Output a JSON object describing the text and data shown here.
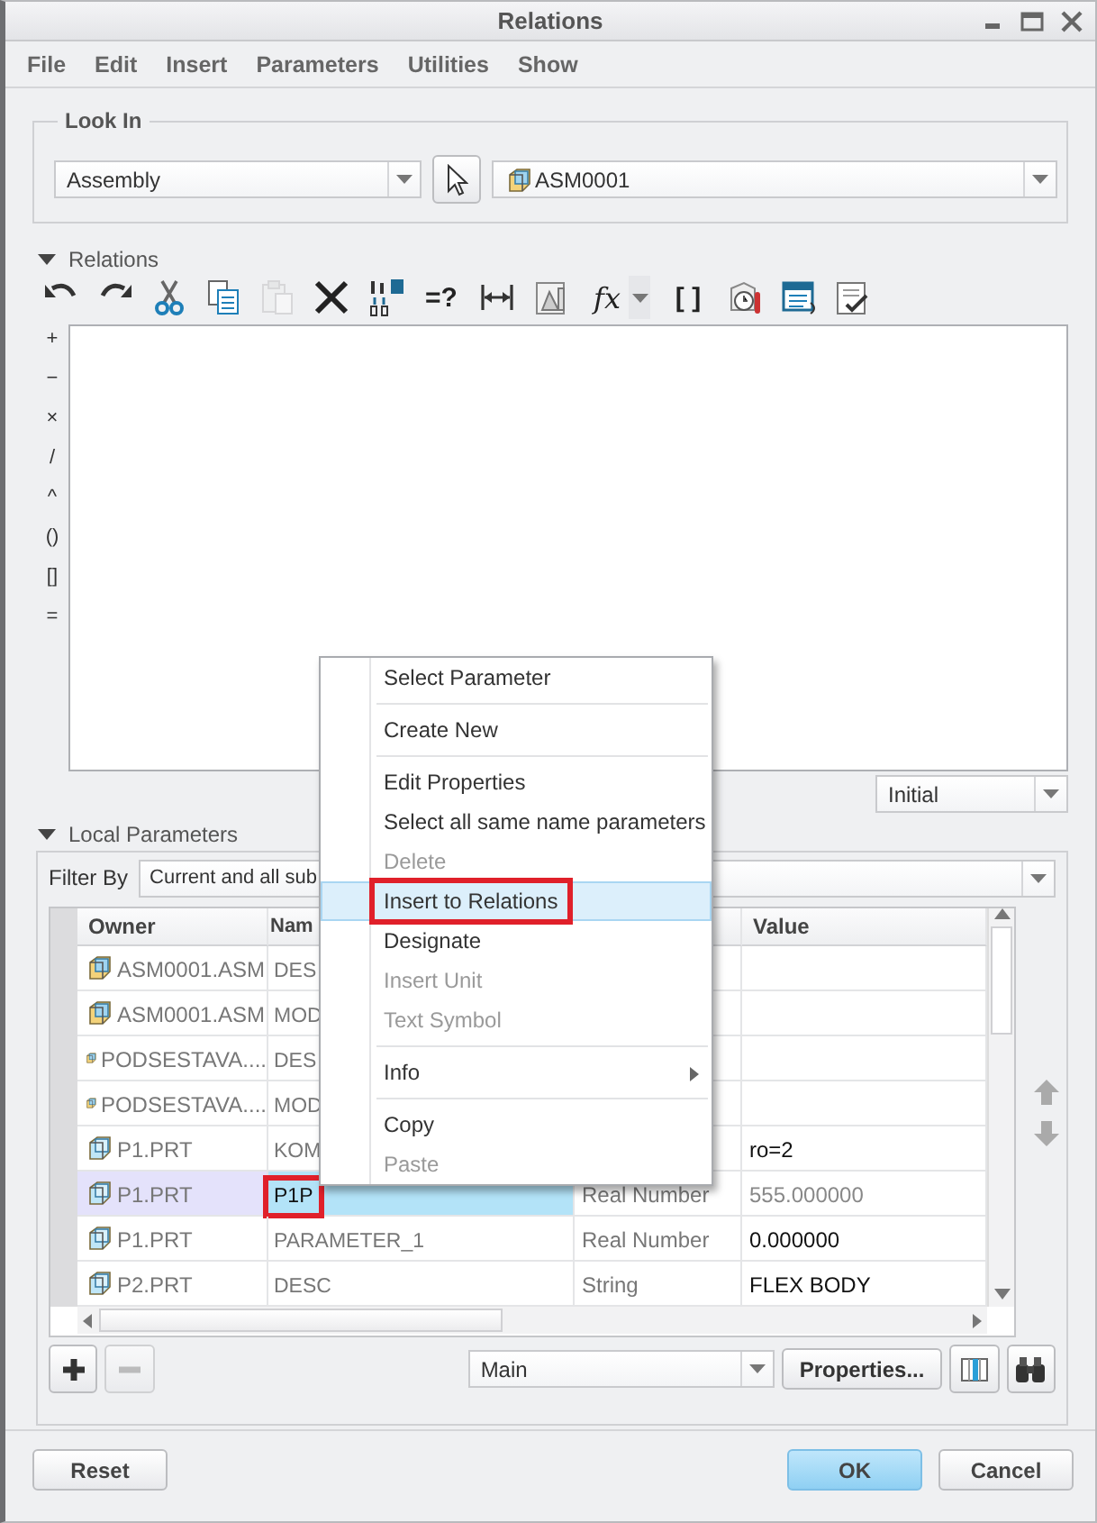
{
  "window": {
    "title": "Relations"
  },
  "menu_bar": [
    "File",
    "Edit",
    "Insert",
    "Parameters",
    "Utilities",
    "Show"
  ],
  "look_in": {
    "label": "Look In",
    "scope": "Assembly",
    "model": "ASM0001"
  },
  "relations": {
    "label": "Relations",
    "expanded": true,
    "toolbar": [
      {
        "kind": "undo",
        "disabled": false
      },
      {
        "kind": "redo",
        "disabled": false
      },
      {
        "kind": "cut",
        "disabled": false
      },
      {
        "kind": "copy",
        "disabled": false
      },
      {
        "kind": "paste",
        "disabled": true
      },
      {
        "kind": "delete",
        "disabled": false
      },
      {
        "kind": "dimension-values",
        "disabled": false
      },
      {
        "kind": "glyph",
        "glyph": "=?",
        "disabled": false
      },
      {
        "kind": "measure",
        "disabled": false
      },
      {
        "kind": "sheet",
        "disabled": false
      },
      {
        "kind": "function",
        "glyph": "fx",
        "disabled": false
      },
      {
        "kind": "glyph",
        "glyph": "[ ]",
        "disabled": false
      },
      {
        "kind": "timer",
        "disabled": false
      },
      {
        "kind": "list",
        "disabled": false
      },
      {
        "kind": "verify",
        "disabled": false
      }
    ],
    "symbols": [
      "+",
      "−",
      "×",
      "/",
      "^",
      "()",
      "[]",
      "="
    ],
    "order": "Initial"
  },
  "local_parameters": {
    "label": "Local Parameters",
    "expanded": true,
    "filter_label": "Filter By",
    "filter": "Current and all sub",
    "columns": [
      "Owner",
      "Nam",
      "Value"
    ],
    "rows": [
      {
        "owner": "ASM0001.ASM",
        "kind": "assembly",
        "name": "DES",
        "selected": false,
        "marked": false
      },
      {
        "owner": "ASM0001.ASM",
        "kind": "assembly",
        "name": "MOD",
        "selected": false,
        "marked": false
      },
      {
        "owner": "PODSESTAVA....",
        "kind": "assembly",
        "name": "DES",
        "selected": false,
        "marked": false
      },
      {
        "owner": "PODSESTAVA....",
        "kind": "assembly",
        "name": "MOD",
        "selected": false,
        "marked": false
      },
      {
        "owner": "P1.PRT",
        "kind": "part",
        "name": "KOM",
        "value": "ro=2",
        "selected": false,
        "locked": false,
        "marked": false
      },
      {
        "owner": "P1.PRT",
        "kind": "part",
        "name": "P1P",
        "type": "Real Number",
        "value": "555.000000",
        "selected": true,
        "locked": true,
        "marked": true
      },
      {
        "owner": "P1.PRT",
        "kind": "part",
        "name": "PARAMETER_1",
        "type": "Real Number",
        "value": "0.000000",
        "selected": false,
        "locked": false,
        "marked": false
      },
      {
        "owner": "P2.PRT",
        "kind": "part",
        "name": "DESC",
        "type": "String",
        "value": "FLEX BODY",
        "selected": false,
        "locked": false,
        "marked": false
      }
    ],
    "view": "Main",
    "properties_button": "Properties..."
  },
  "context_menu": {
    "groups": [
      [
        {
          "label": "Select Parameter",
          "disabled": false,
          "selected": false,
          "submenu": false,
          "marked": false
        }
      ],
      [
        {
          "label": "Create New",
          "disabled": false,
          "selected": false,
          "submenu": false,
          "marked": false
        }
      ],
      [
        {
          "label": "Edit Properties",
          "disabled": false,
          "selected": false,
          "submenu": false,
          "marked": false
        },
        {
          "label": "Select all same name parameters",
          "disabled": false,
          "selected": false,
          "submenu": false,
          "marked": false
        },
        {
          "label": "Delete",
          "disabled": true,
          "selected": false,
          "submenu": false,
          "marked": false
        },
        {
          "label": "Insert to Relations",
          "disabled": false,
          "selected": true,
          "submenu": false,
          "marked": true
        },
        {
          "label": "Designate",
          "disabled": false,
          "selected": false,
          "submenu": false,
          "marked": false
        },
        {
          "label": "Insert Unit",
          "disabled": true,
          "selected": false,
          "submenu": false,
          "marked": false
        },
        {
          "label": "Text Symbol",
          "disabled": true,
          "selected": false,
          "submenu": false,
          "marked": false
        }
      ],
      [
        {
          "label": "Info",
          "disabled": false,
          "selected": false,
          "submenu": true,
          "marked": false
        }
      ],
      [
        {
          "label": "Copy",
          "disabled": false,
          "selected": false,
          "submenu": false,
          "marked": false
        },
        {
          "label": "Paste",
          "disabled": true,
          "selected": false,
          "submenu": false,
          "marked": false
        }
      ]
    ]
  },
  "footer": {
    "reset": "Reset",
    "ok": "OK",
    "cancel": "Cancel"
  }
}
